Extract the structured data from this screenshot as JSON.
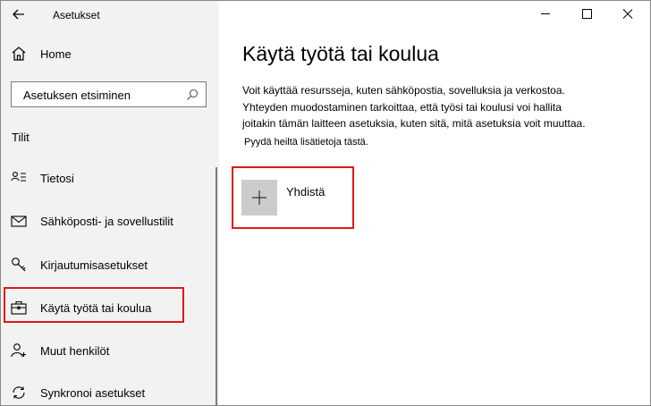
{
  "window": {
    "title": "Asetukset",
    "controls": {
      "minimize_icon": "minimize-icon",
      "maximize_icon": "maximize-icon",
      "close_icon": "close-icon"
    }
  },
  "sidebar": {
    "home_label": "Home",
    "search": {
      "value": "Asetuksen etsiminen"
    },
    "section_title": "Tilit",
    "items": [
      {
        "label": "Tietosi",
        "icon": "person-card-icon"
      },
      {
        "label": "Sähköposti- ja sovellustilit",
        "icon": "mail-icon"
      },
      {
        "label": "Kirjautumisasetukset",
        "icon": "key-icon"
      },
      {
        "label": "Käytä työtä tai koulua",
        "icon": "briefcase-icon",
        "selected": true
      },
      {
        "label": "Muut henkilöt",
        "icon": "person-add-icon"
      },
      {
        "label": "Synkronoi asetukset",
        "icon": "sync-icon"
      }
    ]
  },
  "main": {
    "title": "Käytä työtä tai koulua",
    "description_lines": [
      "Voit käyttää resursseja, kuten sähköpostia, sovelluksia ja verkostoa.",
      "Yhteyden muodostaminen tarkoittaa, että työsi tai koulusi voi hallita",
      "joitakin tämän laitteen asetuksia, kuten sitä, mitä asetuksia voit muuttaa."
    ],
    "note": "Pyydä heiltä lisätietoja tästä.",
    "connect_label": "Yhdistä"
  },
  "colors": {
    "highlight": "#e01818",
    "sidebar_bg": "#f2f2f2",
    "plus_tile": "#cccccc"
  }
}
